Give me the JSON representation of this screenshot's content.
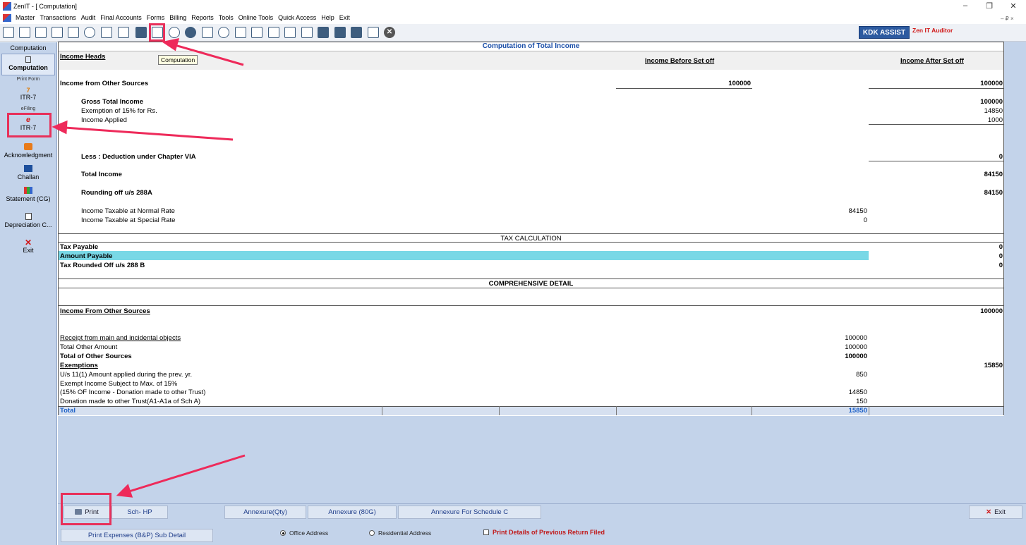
{
  "window": {
    "title": "ZenIT - [ Computation]",
    "minimize": "–",
    "restore": "❐",
    "close": "✕",
    "mdi_controls": "– ₽ ×"
  },
  "menu": [
    "Master",
    "Transactions",
    "Audit",
    "Final Accounts",
    "Forms",
    "Billing",
    "Reports",
    "Tools",
    "Online Tools",
    "Quick Access",
    "Help",
    "Exit"
  ],
  "toolbar": {
    "kdk_assist": "KDK ASSIST",
    "zen_auditor": "Zen IT Auditor",
    "tooltip": "Computation",
    "icons": [
      "home-icon",
      "ledger-icon",
      "building-icon",
      "bar-chart-icon",
      "gift-icon",
      "users-icon",
      "tag-icon",
      "filter-icon",
      "tax-icon",
      "computation-icon",
      "pie-chart-icon",
      "pay-icon",
      "book-icon",
      "info-icon",
      "report-icon",
      "person-doc-icon",
      "calendar-icon",
      "refresh-doc-icon",
      "globe-doc-icon",
      "bs-icon",
      "vat-icon",
      "300-icon",
      "calculator-icon",
      "close-icon"
    ]
  },
  "sidebar": {
    "header": "Computation",
    "active_item": "Computation",
    "print_form_label": "Print Form",
    "itr7_top": "ITR-7",
    "efiling_label": "eFiling",
    "itr7_bottom": "ITR-7",
    "acknowledgment": "Acknowledgment",
    "challan": "Challan",
    "statement": "Statement (CG)",
    "depreciation": "Depreciation C...",
    "exit": "Exit"
  },
  "computation": {
    "title": "Computation of Total Income",
    "income_heads": "Income Heads",
    "col_before": "Income Before Set off",
    "col_after": "Income After Set off",
    "other_sources_label": "Income from Other Sources",
    "other_sources_before": "100000",
    "other_sources_after": "100000",
    "gross_total_label": "Gross Total Income",
    "gross_total_value": "100000",
    "exemption_label": "Exemption of 15% for Rs.",
    "exemption_value": "14850",
    "income_applied_label": "Income Applied",
    "income_applied_value": "1000",
    "deduction_label": "Less : Deduction under Chapter VIA",
    "deduction_value": "0",
    "total_income_label": "Total Income",
    "total_income_value": "84150",
    "rounding_label": "Rounding off u/s 288A",
    "rounding_value": "84150",
    "normal_rate_label": "Income Taxable at Normal Rate",
    "normal_rate_value": "84150",
    "special_rate_label": "Income Taxable at Special Rate",
    "special_rate_value": "0"
  },
  "tax_calc": {
    "header": "TAX CALCULATION",
    "tax_payable_label": "Tax Payable",
    "tax_payable_value": "0",
    "amount_payable_label": "Amount Payable",
    "amount_payable_value": "0",
    "rounded_label": "Tax Rounded Off u/s 288 B",
    "rounded_value": "0"
  },
  "comprehensive": {
    "header": "COMPREHENSIVE DETAIL",
    "ios_label": "Income From Other Sources",
    "ios_value": "100000",
    "receipt_label": "Receipt from main and incidental objects",
    "receipt_value": "100000",
    "total_other_label": "Total Other Amount",
    "total_other_value": "100000",
    "total_sources_label": "Total of Other Sources",
    "total_sources_value": "100000",
    "exemptions_label": "Exemptions",
    "exemptions_value": "15850",
    "us11_label": "U/s 11(1) Amount applied during the prev. yr.",
    "us11_value": "850",
    "exempt_subject_label": "Exempt Income Subject to Max. of 15%",
    "pct_label": "(15% OF Income - Donation made to other Trust)",
    "pct_value": "14850",
    "donation_label": "Donation made to other Trust(A1-A1a of Sch A)",
    "donation_value": "150",
    "total_label": "Total",
    "total_value": "15850"
  },
  "buttons": {
    "print": "Print",
    "sch_hp": "Sch- HP",
    "annexure_qty": "Annexure(Qty)",
    "annexure_80g": "Annexure (80G)",
    "annexure_c": "Annexure For Schedule C",
    "exit": "Exit",
    "print_expenses": "Print Expenses (B&P) Sub Detail",
    "office_address": "Office Address",
    "residential_address": "Residential Address",
    "print_prev": "Print Details of Previous Return Filed"
  }
}
